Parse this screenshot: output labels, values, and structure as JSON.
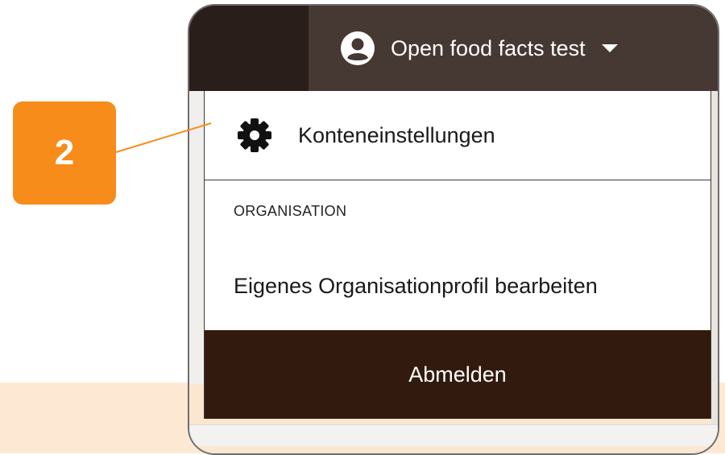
{
  "account_menu": {
    "account_name": "Open food facts test",
    "account_icon": "account-circle-icon",
    "caret_icon": "chevron-down-icon",
    "settings": {
      "label": "Konteneinstellungen",
      "icon": "gear-icon"
    },
    "organisation_heading": "ORGANISATION",
    "org_profile_label": "Eigenes Organisationprofil bearbeiten",
    "logout_label": "Abmelden"
  },
  "annotation": {
    "step_number": "2",
    "badge_color": "#f78c1b"
  },
  "colors": {
    "topbar": "#463833",
    "logout_bg": "#321a0e",
    "accent": "#f78c1b"
  }
}
